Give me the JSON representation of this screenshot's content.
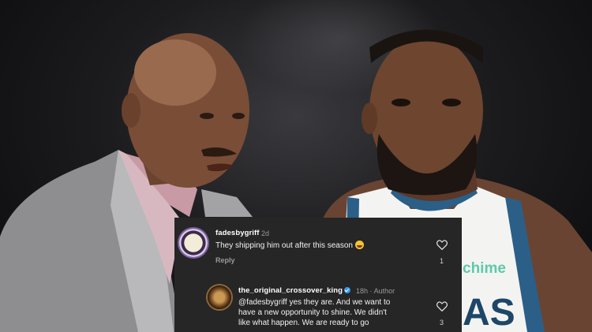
{
  "colors": {
    "panel_bg": "#262626",
    "text": "#f2f2f2",
    "muted": "#9a9a9a",
    "verified": "#3897f0",
    "jersey_trim": "#2b5f87"
  },
  "jersey": {
    "sponsor": "chime",
    "letters": "AS"
  },
  "comments": [
    {
      "username": "fadesbygriff",
      "time": "2d",
      "text": "They shipping him out after this season",
      "emoji_icon": "rolling-on-floor-laughing-emoji",
      "reply_label": "Reply",
      "like_count": "1"
    },
    {
      "username": "the_original_crossover_king",
      "time": "18h",
      "separator": "·",
      "author_label": "Author",
      "text_lines": [
        "@fadesbygriff yes they are. And we want to",
        "have a new opportunity to shine. We didn't",
        "like what happen.  We are ready to go"
      ],
      "like_count": "3"
    }
  ]
}
